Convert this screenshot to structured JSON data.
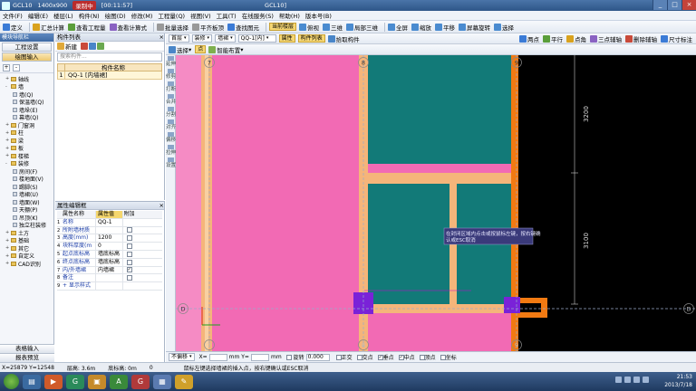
{
  "titlebar": {
    "app": "GCL10",
    "resolution": "1400x900",
    "recording": "录制中",
    "record_time": "[00:11:57]",
    "window_title": "GCL10]"
  },
  "menus": [
    "文件(F)",
    "编辑(E)",
    "楼层(L)",
    "构件(N)",
    "绘图(D)",
    "修改(M)",
    "工程量(Q)",
    "视图(V)",
    "工具(T)",
    "在线服务(S)",
    "帮助(H)",
    "版本号(B)"
  ],
  "toolbar1": [
    {
      "label": "定义",
      "icon": "define-icon",
      "color": "#3b7bd6"
    },
    {
      "label": "汇总计算",
      "icon": "sum-icon",
      "color": "#d9a21e"
    },
    {
      "label": "查看工程量",
      "icon": "view-quantity-icon",
      "color": "#5a9e3a"
    },
    {
      "label": "查看计算式",
      "icon": "formula-icon",
      "color": "#8a62c2"
    },
    {
      "label": "批量选择",
      "icon": "batch-select-icon",
      "color": "#999"
    },
    {
      "label": "平齐板顶",
      "icon": "flush-icon",
      "color": "#999"
    },
    {
      "label": "查找图元",
      "icon": "find-icon",
      "color": "#3b7bd6"
    },
    {
      "label": "当前楼层",
      "icon": "floor-icon",
      "color": "#cc5a2a",
      "highlight": true
    },
    {
      "label": "俯视",
      "icon": "top-view-icon",
      "color": "#4a8bd0"
    },
    {
      "label": "三维",
      "icon": "3d-icon",
      "color": "#4a8bd0"
    },
    {
      "label": "局部三维",
      "icon": "local-3d-icon",
      "color": "#4a8bd0"
    },
    {
      "label": "全屏",
      "icon": "fullscreen-icon",
      "color": "#4a8bd0"
    },
    {
      "label": "缩放",
      "icon": "zoom-icon",
      "color": "#4a8bd0"
    },
    {
      "label": "平移",
      "icon": "pan-icon",
      "color": "#4a8bd0"
    },
    {
      "label": "屏幕旋转",
      "icon": "rotate-icon",
      "color": "#4a8bd0"
    },
    {
      "label": "选择",
      "icon": "select-icon",
      "color": "#4a8bd0"
    }
  ],
  "left_panel": {
    "header": "模块导航栏",
    "btn_settings": "工程设置",
    "btn_draw": "绘图输入",
    "tree": [
      {
        "label": "轴线",
        "indent": 1,
        "folder": true,
        "exp": "+"
      },
      {
        "label": "墙",
        "indent": 1,
        "folder": true,
        "exp": "-"
      },
      {
        "label": "墙(Q)",
        "indent": 3,
        "folder": false
      },
      {
        "label": "保温墙(Q)",
        "indent": 3,
        "folder": false
      },
      {
        "label": "墙垛(E)",
        "indent": 3,
        "folder": false
      },
      {
        "label": "幕墙(Q)",
        "indent": 3,
        "folder": false
      },
      {
        "label": "门窗洞",
        "indent": 1,
        "folder": true,
        "exp": "+"
      },
      {
        "label": "柱",
        "indent": 1,
        "folder": true,
        "exp": "+"
      },
      {
        "label": "梁",
        "indent": 1,
        "folder": true,
        "exp": "+"
      },
      {
        "label": "板",
        "indent": 1,
        "folder": true,
        "exp": "+"
      },
      {
        "label": "楼梯",
        "indent": 1,
        "folder": true,
        "exp": "+"
      },
      {
        "label": "装修",
        "indent": 1,
        "folder": true,
        "exp": "-"
      },
      {
        "label": "房间(F)",
        "indent": 3,
        "folder": false
      },
      {
        "label": "楼地面(V)",
        "indent": 3,
        "folder": false
      },
      {
        "label": "踢脚(S)",
        "indent": 3,
        "folder": false
      },
      {
        "label": "墙裙(U)",
        "indent": 3,
        "folder": false
      },
      {
        "label": "墙面(W)",
        "indent": 3,
        "folder": false
      },
      {
        "label": "天棚(P)",
        "indent": 3,
        "folder": false
      },
      {
        "label": "吊顶(K)",
        "indent": 3,
        "folder": false
      },
      {
        "label": "独立柱装修",
        "indent": 3,
        "folder": false
      },
      {
        "label": "土方",
        "indent": 1,
        "folder": true,
        "exp": "+"
      },
      {
        "label": "基础",
        "indent": 1,
        "folder": true,
        "exp": "+"
      },
      {
        "label": "其它",
        "indent": 1,
        "folder": true,
        "exp": "+"
      },
      {
        "label": "自定义",
        "indent": 1,
        "folder": true,
        "exp": "+"
      },
      {
        "label": "CAD识别",
        "indent": 1,
        "folder": true,
        "exp": "+"
      }
    ],
    "btn_table": "表格输入",
    "btn_report": "报表预览"
  },
  "component_list": {
    "header": "构件列表",
    "new_label": "新建",
    "search_placeholder": "搜索构件...",
    "col_name": "构件名称",
    "rows": [
      {
        "idx": "1",
        "name": "QQ-1 [内墙裙]"
      }
    ]
  },
  "property_panel": {
    "header": "属性编辑框",
    "col_name": "属性名称",
    "col_value": "属性值",
    "col_add": "附加",
    "rows": [
      {
        "idx": "1",
        "name": "名称",
        "value": "QQ-1",
        "checked": false,
        "has_cb": false
      },
      {
        "idx": "2",
        "name": "所附墙材质",
        "value": "",
        "checked": false,
        "has_cb": true
      },
      {
        "idx": "3",
        "name": "高度(mm)",
        "value": "1200",
        "checked": false,
        "has_cb": true
      },
      {
        "idx": "4",
        "name": "块料厚度(m",
        "value": "0",
        "checked": false,
        "has_cb": true
      },
      {
        "idx": "5",
        "name": "起点底标高",
        "value": "墙底标高",
        "checked": false,
        "has_cb": true
      },
      {
        "idx": "6",
        "name": "终点底标高",
        "value": "墙底标高",
        "checked": false,
        "has_cb": true
      },
      {
        "idx": "7",
        "name": "内/外墙裙",
        "value": "内墙裙",
        "checked": true,
        "has_cb": true
      },
      {
        "idx": "8",
        "name": "备注",
        "value": "",
        "checked": false,
        "has_cb": true
      },
      {
        "idx": "9",
        "name": "显示样式",
        "value": "",
        "checked": false,
        "has_cb": false,
        "expand": "+"
      }
    ]
  },
  "toolbar2": {
    "floor": "首层",
    "category": "装修",
    "subcategory": "墙裙",
    "component": "QQ-1[内]",
    "btn_attr": "属性",
    "btn_comp": "构件列表",
    "btn_pick": "拾取构件",
    "right": [
      "两点",
      "平行",
      "点角",
      "三点辅轴",
      "删除辅轴",
      "尺寸标注"
    ]
  },
  "toolbar3": {
    "select": "选择",
    "point": "点",
    "smart": "智能布置"
  },
  "vtools": [
    "延伸",
    "修剪",
    "打断",
    "合并",
    "分割",
    "对齐",
    "偏移",
    "拉伸",
    "设置"
  ],
  "canvas": {
    "axis_top": [
      "7",
      "8",
      "9"
    ],
    "axis_bottom": [
      "7",
      "8",
      "9"
    ],
    "axis_left": "D",
    "axis_right": "D",
    "dim_upper": "3200",
    "dim_lower": "3100",
    "tooltip_line1": "在封闭区域内点击或按鼠标左键，按右键确",
    "tooltip_line2": "认或ESC取消"
  },
  "statusbar": {
    "ortho": "不偏移",
    "x_label": "X=",
    "x_unit": "mm Y=",
    "y_unit": "mm",
    "rotate": "旋转",
    "rotate_val": "0.000",
    "snap": [
      "正交",
      "交点",
      "垂点",
      "中点",
      "顶点",
      "坐标"
    ],
    "hint": "鼠标左键选择墙裙的插入点，按右键确认或ESC取消"
  },
  "status2": {
    "coord": "X=25879 Y=12548",
    "floor_h": "层高: 3.6m",
    "base_h": "底标高: 0m",
    "zero": "0"
  },
  "taskbar": {
    "time": "21:53",
    "date": "2013/7/18"
  }
}
